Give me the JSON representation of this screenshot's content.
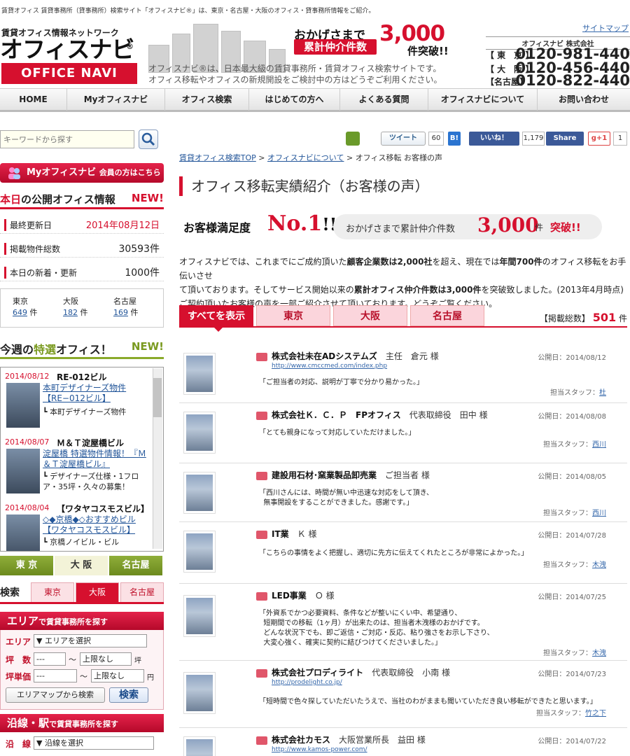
{
  "topline": "賃貸オフィス 賃貸事務所（貸事務所）検索サイト「オフィスナビ®」は、東京・名古屋・大阪のオフィス・貸事務所情報をご紹介。",
  "sitemap": "サイトマップ",
  "logo": {
    "sub": "賃貸オフィス情報ネットワーク",
    "main": "オフィスナビ",
    "reg": "®",
    "bar": "OFFICE NAVI"
  },
  "header_desc": [
    "オフィスナビ®は、日本最大級の賃貸事務所・賃貸オフィス検索サイトです。",
    "オフィス移転やオフィスの新規開設をご検討中の方はどうぞご利用ください。"
  ],
  "banner": {
    "top": "おかげさまで",
    "box": "累計仲介件数",
    "num": "3,000",
    "end": "件突破!!"
  },
  "company": "オフィスナビ 株式会社",
  "phones": [
    {
      "label": "【 東　京 】",
      "number": "0120-981-440"
    },
    {
      "label": "【 大　阪 】",
      "number": "0120-456-440"
    },
    {
      "label": "【名古屋】",
      "number": "0120-822-440"
    }
  ],
  "nav": [
    "HOME",
    "Myオフィスナビ",
    "オフィス検索",
    "はじめての方へ",
    "よくある質問",
    "オフィスナビについて",
    "お問い合わせ"
  ],
  "search": {
    "placeholder": "キーワードから探す"
  },
  "mybutton": {
    "main": "Myオフィスナビ",
    "sub": "会員の方はこちら"
  },
  "today": {
    "title_a": "本日",
    "title_b": "の公開オフィス情報",
    "new": "NEW!",
    "updated_label": "最終更新日",
    "updated": "2014年08月12日",
    "count_label": "掲載物件総数",
    "count": "30593件",
    "new_label": "本日の新着・更新",
    "new_count": "1000件",
    "cities": [
      {
        "name": "東京",
        "count": "649",
        "unit": "件"
      },
      {
        "name": "大阪",
        "count": "182",
        "unit": "件"
      },
      {
        "name": "名古屋",
        "count": "169",
        "unit": "件"
      }
    ]
  },
  "weekly": {
    "title_a": "今週の",
    "title_b": "特選",
    "title_c": "オフィス！",
    "new": "NEW!",
    "items": [
      {
        "date": "2014/08/12",
        "name": "RE-012ビル",
        "link": "本町デザイナーズ物件【RE−012ビル】",
        "desc": "┗ 本町デザイナーズ物件"
      },
      {
        "date": "2014/08/07",
        "name": "Ｍ＆Ｔ淀屋橋ビル",
        "link": "淀屋橋 特選物件情報！『Ｍ＆Ｔ淀屋橋ビル』",
        "desc": "┗ デザイナーズ仕様・1フロア・35坪・久々の募集！"
      },
      {
        "date": "2014/08/04",
        "name": "【ワタヤコスモスビル】",
        "link": "◇◆京橋◆◇おすすめビル【ワタヤコスモスビル】",
        "desc": "┗ 京橋ノイビル・ビル"
      }
    ]
  },
  "region_tabs": [
    "東 京",
    "大 阪",
    "名古屋"
  ],
  "search_section": {
    "label": "検索",
    "tabs": [
      "東京",
      "大阪",
      "名古屋"
    ]
  },
  "area": {
    "head": "エリア",
    "head_sub": "で賃貸事務所を探す",
    "area_label": "エリア",
    "area_select": "▼ エリアを選択",
    "tsubo_label": "坪　数",
    "tsubo_from": "---",
    "tsubo_to": "上限なし",
    "tsubo_unit": "坪",
    "tilde": "～",
    "price_label": "坪単価",
    "price_from": "---",
    "price_to": "上限なし",
    "price_unit": "円",
    "map_btn": "エリアマップから検索",
    "search_btn": "検索"
  },
  "ensen": {
    "head": "沿線・駅",
    "head_sub": "で賃貸事務所を探す",
    "label": "沿　線",
    "select": "▼ 沿線を選択"
  },
  "social": {
    "tweet": "ツイート",
    "tweet_count": "60",
    "hatena": "B!",
    "like": "いいね！",
    "like_count": "1,179",
    "share": "Share",
    "gplus": "g+1",
    "gplus_count": "1"
  },
  "breadcrumb": {
    "home": "賃貸オフィス検索TOP",
    "sep": " > ",
    "about": "オフィスナビについて",
    "current": "オフィス移転 お客様の声"
  },
  "page_title": "オフィス移転実績紹介（お客様の声）",
  "satisfaction": {
    "text": "お客様満足度",
    "no1": "No.1",
    "marks": "!!",
    "pill_text": "おかげさまで累計仲介件数",
    "pill_num": "3,000",
    "pill_unit": "件",
    "pill_end": "突破!!"
  },
  "intro": {
    "l1a": "オフィスナビでは、これまでにご成約頂いた",
    "l1b": "顧客企業数は2,000社",
    "l1c": "を超え、現在では",
    "l1d": "年間700件",
    "l1e": "のオフィス移転をお手伝いさせ",
    "l2a": "て頂いております。そしてサービス開始以来の",
    "l2b": "累計オフィス仲介件数は3,000件",
    "l2c": "を突破致しました。(2013年4月時点)",
    "l3": "ご契約頂いたお客様の声を一部ご紹介させて頂いております。どうぞご覧ください。"
  },
  "filter_tabs": [
    "すべてを表示",
    "東京",
    "大阪",
    "名古屋"
  ],
  "total": {
    "label": "【掲載総数】",
    "num": "501",
    "unit": "件"
  },
  "entries": [
    {
      "company": "株式会社未在ADシステムズ",
      "person": "主任　倉元 様",
      "date": "公開日：2014/08/12",
      "url": "http://www.cmccmed.com/index.php",
      "comment": "「ご担当者の対応、説明が丁寧で分かり易かった。」",
      "staff_label": "担当スタッフ：",
      "staff": "杜"
    },
    {
      "company": "株式会社Ｋ．Ｃ．Ｐ　FPオフィス",
      "person": "代表取締役　田中 様",
      "date": "公開日：2014/08/08",
      "url": "",
      "comment": "「とても親身になって対応していただけました。」",
      "staff_label": "担当スタッフ：",
      "staff": "西川"
    },
    {
      "company": "建設用石材･窯業製品卸売業",
      "person": "ご担当者 様",
      "date": "公開日：2014/08/05",
      "url": "",
      "comment": "「西川さんには、時間が無い中迅速な対応をして頂き、\n  無事開設をすることができました。感謝です。」",
      "staff_label": "担当スタッフ：",
      "staff": "西川"
    },
    {
      "company": "IT業",
      "person": "Ｋ 様",
      "date": "公開日：2014/07/28",
      "url": "",
      "comment": "「こちらの事情をよく把握し、適切に先方に伝えてくれたところが非常によかった。」",
      "staff_label": "担当スタッフ：",
      "staff": "木洩"
    },
    {
      "company": "LED事業",
      "person": "Ｏ 様",
      "date": "公開日：2014/07/25",
      "url": "",
      "comment": "「外資系でかつ必要資料、条件などが整いにくい中、希望通り、\n  短期間での移転（1ヶ月）が出来たのは、担当者木洩様のおかげです。\n  どんな状況下でも、即ご返信・ご対応・反応、粘り強さをお示し下さり、\n  大変心強く、確実に契約に結びつけてくださいました。」",
      "staff_label": "担当スタッフ：",
      "staff": "木洩"
    },
    {
      "company": "株式会社プロディライト",
      "person": "代表取締役　小南 様",
      "date": "公開日：2014/07/23",
      "url": "http://prodelight.co.jp/",
      "comment": "「短時間で色々探していただいたうえで、当社のわがままも聞いていただき良い移転ができたと思います。」",
      "staff_label": "担当スタッフ：",
      "staff": "竹之下"
    },
    {
      "company": "株式会社カモス",
      "person": "大阪営業所長　益田 様",
      "date": "公開日：2014/07/22",
      "url": "http://www.kamos-power.com/",
      "comment": "",
      "staff_label": "",
      "staff": ""
    }
  ]
}
